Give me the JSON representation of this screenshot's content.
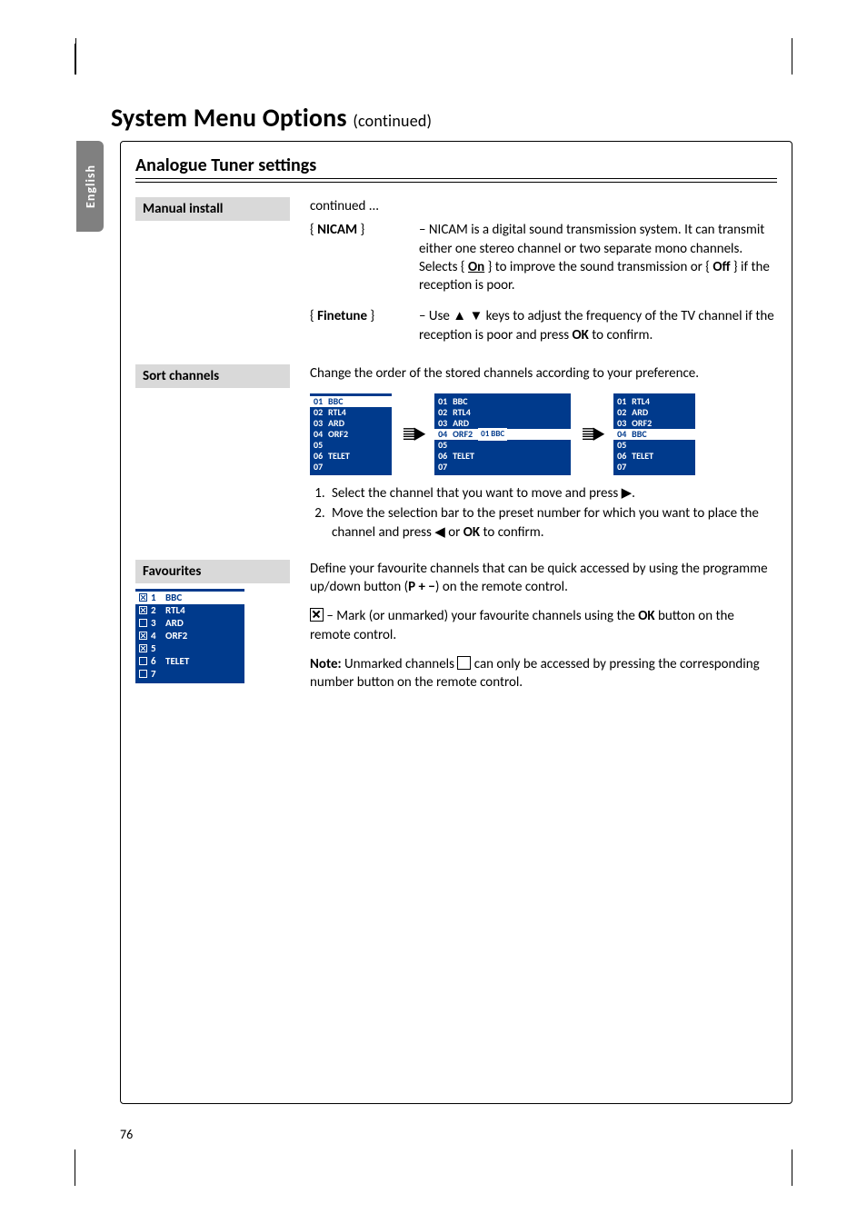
{
  "side_tab": "English",
  "title_main": "System Menu Options",
  "title_cont": "(continued)",
  "section_heading": "Analogue Tuner settings",
  "manual_install": {
    "label": "Manual install",
    "continued": "continued ...",
    "nicam_key": "{ NICAM }",
    "nicam_desc_pre": "– NICAM is a digital sound transmission system. It can transmit either one stereo channel or two separate mono channels. Selects { ",
    "nicam_on": "On",
    "nicam_mid": " } to improve the sound transmission or { ",
    "nicam_off": "Off",
    "nicam_desc_post": " } if the reception is poor.",
    "finetune_key": "{ Finetune }",
    "finetune_desc_pre": "– Use ▲ ▼ keys to adjust the frequency of the TV channel if the reception is poor and press ",
    "finetune_ok": "OK",
    "finetune_desc_post": " to confirm."
  },
  "sort": {
    "label": "Sort channels",
    "intro": "Change the order of the stored channels according to your preference.",
    "box1": [
      {
        "n": "01",
        "t": "BBC",
        "hl": true
      },
      {
        "n": "02",
        "t": "RTL4"
      },
      {
        "n": "03",
        "t": "ARD"
      },
      {
        "n": "04",
        "t": "ORF2"
      },
      {
        "n": "05",
        "t": ""
      },
      {
        "n": "06",
        "t": "TELET"
      },
      {
        "n": "07",
        "t": ""
      }
    ],
    "box2": [
      {
        "n": "01",
        "t": "BBC"
      },
      {
        "n": "02",
        "t": "RTL4"
      },
      {
        "n": "03",
        "t": "ARD"
      },
      {
        "n": "04",
        "t": "ORF2",
        "hl": true,
        "tag": "01  BBC"
      },
      {
        "n": "05",
        "t": ""
      },
      {
        "n": "06",
        "t": "TELET"
      },
      {
        "n": "07",
        "t": ""
      }
    ],
    "box3": [
      {
        "n": "01",
        "t": "RTL4"
      },
      {
        "n": "02",
        "t": "ARD"
      },
      {
        "n": "03",
        "t": "ORF2"
      },
      {
        "n": "04",
        "t": "BBC",
        "hl": true
      },
      {
        "n": "05",
        "t": ""
      },
      {
        "n": "06",
        "t": "TELET"
      },
      {
        "n": "07",
        "t": ""
      }
    ],
    "step1": "Select the channel that you want to move and press ▶.",
    "step2_pre": "Move the selection bar to the preset number for which you want to place the channel and press ◀ or ",
    "step2_ok": "OK",
    "step2_post": " to confirm."
  },
  "fav": {
    "label": "Favourites",
    "rows": [
      {
        "n": "1",
        "t": "BBC",
        "chk": true,
        "hl": true
      },
      {
        "n": "2",
        "t": "RTL4",
        "chk": true
      },
      {
        "n": "3",
        "t": "ARD",
        "chk": false
      },
      {
        "n": "4",
        "t": "ORF2",
        "chk": true
      },
      {
        "n": "5",
        "t": "",
        "chk": true
      },
      {
        "n": "6",
        "t": "TELET",
        "chk": false
      },
      {
        "n": "7",
        "t": "",
        "chk": false
      }
    ],
    "intro_pre": "Define your favourite channels that can be quick accessed by using the programme up/down button (",
    "intro_bold": "P + −",
    "intro_post": ") on the remote control.",
    "mark_pre": " –  Mark (or unmarked) your favourite channels using the ",
    "mark_ok": "OK",
    "mark_post": " button on the remote control.",
    "note_bold": "Note:",
    "note_pre": "  Unmarked channels ",
    "note_post": " can only be accessed by pressing the corresponding number button on the remote control."
  },
  "page_number": "76"
}
